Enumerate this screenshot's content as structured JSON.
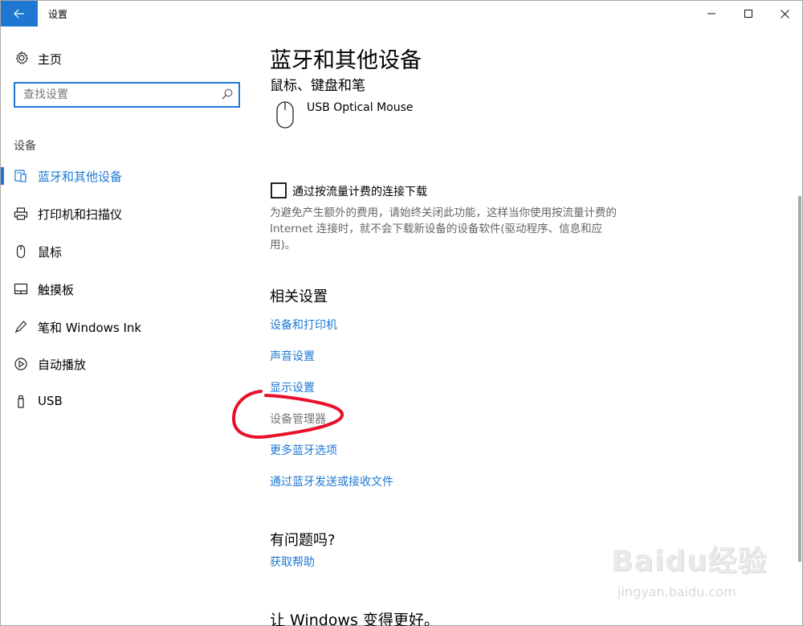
{
  "window": {
    "title": "设置"
  },
  "nav": {
    "home_label": "主页",
    "search_placeholder": "查找设置",
    "section_label": "设备",
    "items": [
      {
        "label": "蓝牙和其他设备",
        "icon": "bluetooth-devices-icon",
        "active": true
      },
      {
        "label": "打印机和扫描仪",
        "icon": "printer-icon",
        "active": false
      },
      {
        "label": "鼠标",
        "icon": "mouse-icon",
        "active": false
      },
      {
        "label": "触摸板",
        "icon": "touchpad-icon",
        "active": false
      },
      {
        "label": "笔和 Windows Ink",
        "icon": "pen-icon",
        "active": false
      },
      {
        "label": "自动播放",
        "icon": "autoplay-icon",
        "active": false
      },
      {
        "label": "USB",
        "icon": "usb-icon",
        "active": false
      }
    ]
  },
  "main": {
    "title": "蓝牙和其他设备",
    "mouse_section": "鼠标、键盘和笔",
    "device_name": "USB Optical Mouse",
    "metered_checkbox": {
      "label": "通过按流量计费的连接下载",
      "checked": false,
      "description": "为避免产生额外的费用，请始终关闭此功能，这样当你使用按流量计费的 Internet 连接时，就不会下载新设备的设备软件(驱动程序、信息和应用)。"
    },
    "related_heading": "相关设置",
    "related_links": [
      "设备和打印机",
      "声音设置",
      "显示设置",
      "设备管理器",
      "更多蓝牙选项",
      "通过蓝牙发送或接收文件"
    ],
    "question_heading": "有问题吗?",
    "help_link": "获取帮助",
    "better_heading": "让 Windows 变得更好。"
  },
  "watermark": {
    "brand": "Baidu经验",
    "url": "jingyan.baidu.com"
  },
  "colors": {
    "accent": "#1e78d2",
    "annotation": "#e8102a"
  }
}
